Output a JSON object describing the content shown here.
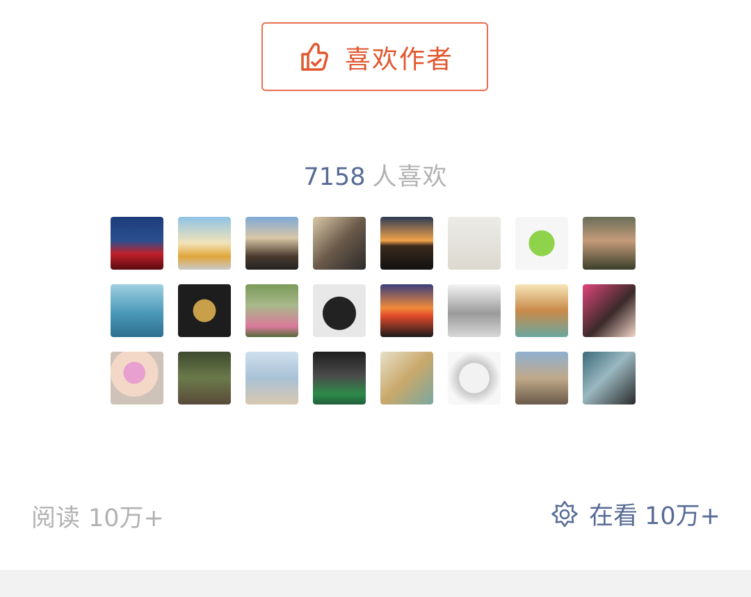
{
  "like_author": {
    "label": "喜欢作者",
    "icon": "thumbs-up-icon",
    "color": "#e2572f"
  },
  "likes": {
    "count": "7158",
    "suffix": "人喜欢"
  },
  "avatars": [
    {
      "name": "avatar-1"
    },
    {
      "name": "avatar-2"
    },
    {
      "name": "avatar-3"
    },
    {
      "name": "avatar-4"
    },
    {
      "name": "avatar-5"
    },
    {
      "name": "avatar-6"
    },
    {
      "name": "avatar-7"
    },
    {
      "name": "avatar-8"
    },
    {
      "name": "avatar-9"
    },
    {
      "name": "avatar-10"
    },
    {
      "name": "avatar-11"
    },
    {
      "name": "avatar-12"
    },
    {
      "name": "avatar-13"
    },
    {
      "name": "avatar-14"
    },
    {
      "name": "avatar-15"
    },
    {
      "name": "avatar-16"
    },
    {
      "name": "avatar-17"
    },
    {
      "name": "avatar-18"
    },
    {
      "name": "avatar-19"
    },
    {
      "name": "avatar-20"
    },
    {
      "name": "avatar-21"
    },
    {
      "name": "avatar-22"
    },
    {
      "name": "avatar-23"
    },
    {
      "name": "avatar-24"
    }
  ],
  "footer": {
    "read_label": "阅读",
    "read_value": "10万+",
    "watching_label": "在看",
    "watching_value": "10万+",
    "watching_icon": "wow-star-icon",
    "link_color": "#576b95"
  }
}
